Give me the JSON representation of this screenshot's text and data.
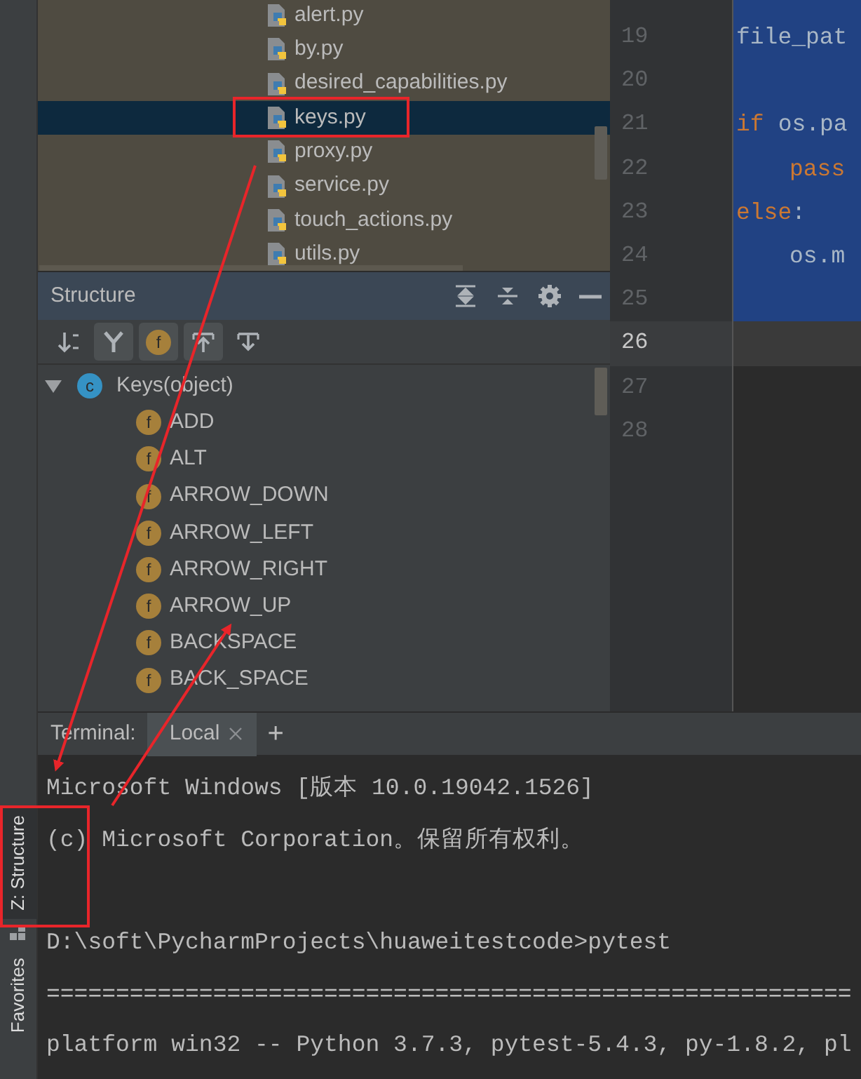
{
  "project_files": [
    {
      "name": "alert.py",
      "selected": false
    },
    {
      "name": "by.py",
      "selected": false
    },
    {
      "name": "desired_capabilities.py",
      "selected": false
    },
    {
      "name": "keys.py",
      "selected": true
    },
    {
      "name": "proxy.py",
      "selected": false
    },
    {
      "name": "service.py",
      "selected": false
    },
    {
      "name": "touch_actions.py",
      "selected": false
    },
    {
      "name": "utils.py",
      "selected": false
    }
  ],
  "editor": {
    "lines": [
      {
        "number": "19",
        "selected": true,
        "current": false,
        "indented": false,
        "code": [
          {
            "text": "file_pat",
            "kind": "plain"
          }
        ]
      },
      {
        "number": "20",
        "selected": true,
        "current": false,
        "indented": false
      },
      {
        "number": "21",
        "selected": true,
        "current": false,
        "indented": false,
        "code": [
          {
            "text": "if",
            "kind": "keyword"
          },
          {
            "text": "os.pa",
            "kind": "plain"
          }
        ]
      },
      {
        "number": "22",
        "selected": true,
        "current": false,
        "indented": true,
        "code": [
          {
            "text": "pass",
            "kind": "keyword"
          }
        ]
      },
      {
        "number": "23",
        "selected": true,
        "current": false,
        "indented": false,
        "code": [
          {
            "text": "else",
            "kind": "keyword"
          },
          {
            "text": ":",
            "kind": "plain"
          }
        ]
      },
      {
        "number": "24",
        "selected": true,
        "current": false,
        "indented": true,
        "code": [
          {
            "text": "os.m",
            "kind": "plain"
          }
        ]
      },
      {
        "number": "25",
        "selected": true,
        "current": false,
        "indented": false
      },
      {
        "number": "26",
        "selected": false,
        "current": true,
        "indented": false
      },
      {
        "number": "27",
        "selected": false,
        "current": false,
        "indented": false
      },
      {
        "number": "28",
        "selected": false,
        "current": false,
        "indented": false
      }
    ]
  },
  "structure": {
    "title": "Structure",
    "header_buttons": [
      {
        "kind": "expand"
      },
      {
        "kind": "collapse"
      },
      {
        "kind": "settings"
      },
      {
        "kind": "minimize"
      }
    ],
    "toolbar": [
      {
        "kind": "sort",
        "selected": false
      },
      {
        "kind": "inherited",
        "selected": true
      },
      {
        "kind": "fields",
        "label": "f",
        "selected": true
      },
      {
        "kind": "autoscroll-to",
        "selected": true
      },
      {
        "kind": "autoscroll-from",
        "selected": false
      }
    ],
    "tree": {
      "label": "Keys(object)",
      "badge": "c",
      "kind": "class",
      "expanded": true,
      "children": [
        {
          "label": "ADD",
          "badge": "f",
          "kind": "field"
        },
        {
          "label": "ALT",
          "badge": "f",
          "kind": "field"
        },
        {
          "label": "ARROW_DOWN",
          "badge": "f",
          "kind": "field"
        },
        {
          "label": "ARROW_LEFT",
          "badge": "f",
          "kind": "field"
        },
        {
          "label": "ARROW_RIGHT",
          "badge": "f",
          "kind": "field"
        },
        {
          "label": "ARROW_UP",
          "badge": "f",
          "kind": "field"
        },
        {
          "label": "BACKSPACE",
          "badge": "f",
          "kind": "field"
        },
        {
          "label": "BACK_SPACE",
          "badge": "f",
          "kind": "field"
        }
      ]
    }
  },
  "terminal": {
    "label": "Terminal:",
    "tabs": [
      {
        "label": "Local",
        "selected": true
      }
    ],
    "add": "+",
    "lines": [
      {
        "text": "Microsoft Windows [版本 10.0.19042.1526]",
        "blank_before": false
      },
      {
        "text": "(c) Microsoft Corporation。保留所有权利。",
        "blank_before": false
      },
      {
        "text": "D:\\soft\\PycharmProjects\\huaweitestcode>pytest",
        "blank_before": true
      },
      {
        "text": "==========================================================",
        "blank_before": false
      },
      {
        "text": "platform win32 -- Python 3.7.3, pytest-5.4.3, py-1.8.2, pl",
        "blank_before": false
      }
    ]
  },
  "side_tabs": [
    {
      "label": "Z: Structure",
      "selected": true,
      "kind": "structure"
    },
    {
      "label": "Favorites",
      "selected": false,
      "kind": "favorites"
    }
  ]
}
